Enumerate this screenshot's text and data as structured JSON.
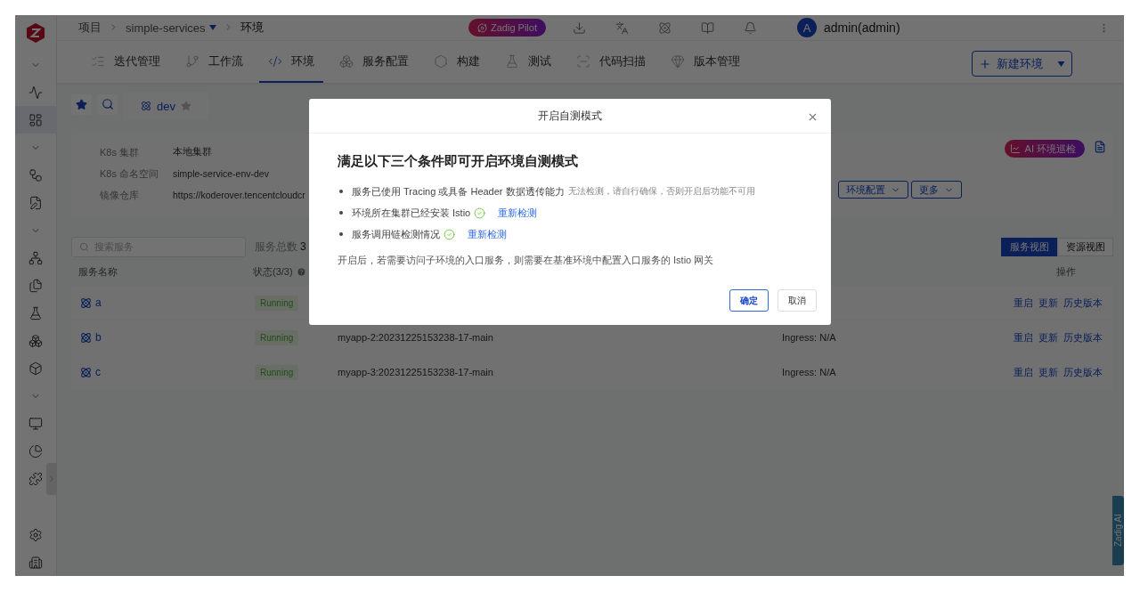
{
  "breadcrumb": [
    {
      "label": "项目",
      "dropdown": false
    },
    {
      "label": "simple-services",
      "dropdown": true
    },
    {
      "label": "环境",
      "dropdown": false
    }
  ],
  "header": {
    "pilot": "Zadig Pilot",
    "user": {
      "avatar": "A",
      "name": "admin(admin)"
    }
  },
  "nav_tabs": [
    {
      "label": "迭代管理",
      "selected": false
    },
    {
      "label": "工作流",
      "selected": false
    },
    {
      "label": "环境",
      "selected": true
    },
    {
      "label": "服务配置",
      "selected": false
    },
    {
      "label": "构建",
      "selected": false
    },
    {
      "label": "测试",
      "selected": false
    },
    {
      "label": "代码扫描",
      "selected": false
    },
    {
      "label": "版本管理",
      "selected": false
    }
  ],
  "new_env_button": "新建环境",
  "env_tabs": [
    {
      "label": "dev",
      "selected": true,
      "starred": false
    }
  ],
  "env_info": [
    {
      "label": "K8s 集群",
      "value": "本地集群"
    },
    {
      "label": "K8s 命名空间",
      "value": "simple-service-env-dev"
    },
    {
      "label": "镜像仓库",
      "value": "https://koderover.tencentcloudcr"
    }
  ],
  "ai_button": "AI 环境巡检",
  "env_actions": [
    "环境配置",
    "更多"
  ],
  "search": {
    "placeholder": "搜索服务"
  },
  "total": {
    "label": "服务总数",
    "value": "3"
  },
  "views": [
    {
      "label": "服务视图",
      "selected": true
    },
    {
      "label": "资源视图",
      "selected": false
    }
  ],
  "table": {
    "columns": [
      "服务名称",
      "状态(3/3)",
      "操作"
    ],
    "rows": [
      {
        "name": "a",
        "status": "Running",
        "actions": [
          "重启",
          "更新",
          "历史版本"
        ]
      },
      {
        "name": "b",
        "status": "Running",
        "image": "myapp-2:20231225153238-17-main",
        "ingress": "Ingress: N/A",
        "actions": [
          "重启",
          "更新",
          "历史版本"
        ]
      },
      {
        "name": "c",
        "status": "Running",
        "image": "myapp-3:20231225153238-17-main",
        "ingress": "Ingress: N/A",
        "actions": [
          "重启",
          "更新",
          "历史版本"
        ]
      }
    ]
  },
  "side_tab": "Zadig AI",
  "dialog": {
    "title": "开启自测模式",
    "heading": "满足以下三个条件即可开启环境自测模式",
    "conditions": [
      {
        "kind": "note",
        "text": "服务已使用 Tracing 或具备 Header 数据透传能力",
        "note": "无法检测，请自行确保，否则开启后功能不可用"
      },
      {
        "kind": "check",
        "text": "环境所在集群已经安装 Istio",
        "checked": true,
        "link": "重新检测"
      },
      {
        "kind": "check",
        "text": "服务调用链检测情况",
        "checked": true,
        "link": "重新检测"
      }
    ],
    "footer_note": "开启后，若需要访问子环境的入口服务，则需要在基准环境中配置入口服务的 Istio 网关",
    "buttons": [
      {
        "label": "确定",
        "primary": true
      },
      {
        "label": "取消",
        "primary": false
      }
    ]
  }
}
